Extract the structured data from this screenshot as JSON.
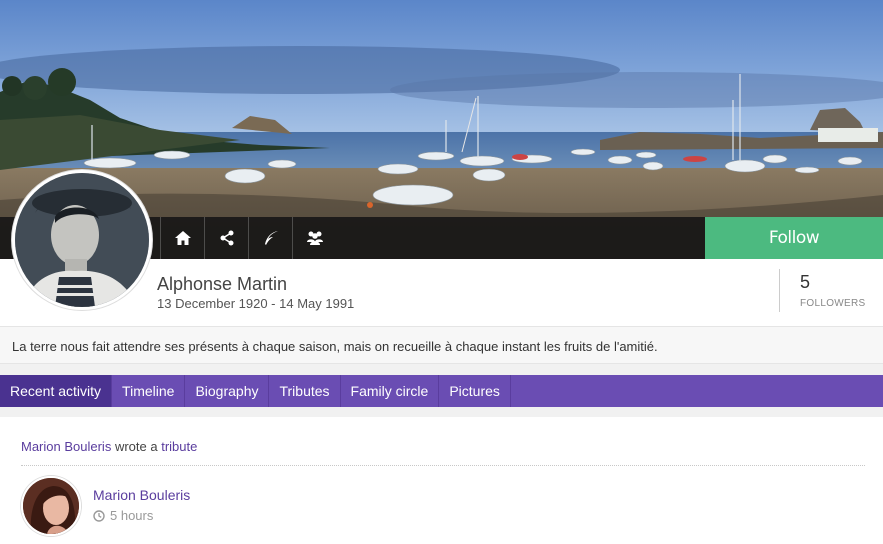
{
  "profile": {
    "name": "Alphonse Martin",
    "dates": "13 December 1920 - 14 May 1991",
    "followers_count": "5",
    "followers_label": "FOLLOWERS",
    "quote": "La terre nous fait attendre ses présents à chaque saison, mais on recueille à chaque instant les fruits de l'amitié."
  },
  "actions": {
    "icons": [
      "home-icon",
      "share-icon",
      "feather-icon",
      "group-icon"
    ],
    "follow_label": "Follow"
  },
  "tabs": [
    {
      "label": "Recent activity",
      "active": true
    },
    {
      "label": "Timeline",
      "active": false
    },
    {
      "label": "Biography",
      "active": false
    },
    {
      "label": "Tributes",
      "active": false
    },
    {
      "label": "Family circle",
      "active": false
    },
    {
      "label": "Pictures",
      "active": false
    }
  ],
  "feed": {
    "actor": "Marion Bouleris",
    "verb": "wrote a",
    "object": "tribute",
    "author": "Marion Bouleris",
    "time": "5 hours",
    "time_icon": "clock-icon"
  },
  "colors": {
    "follow_green": "#4cba80",
    "tab_purple": "#6a4db3",
    "tab_active": "#4a3290",
    "link_purple": "#5a3d9e"
  }
}
